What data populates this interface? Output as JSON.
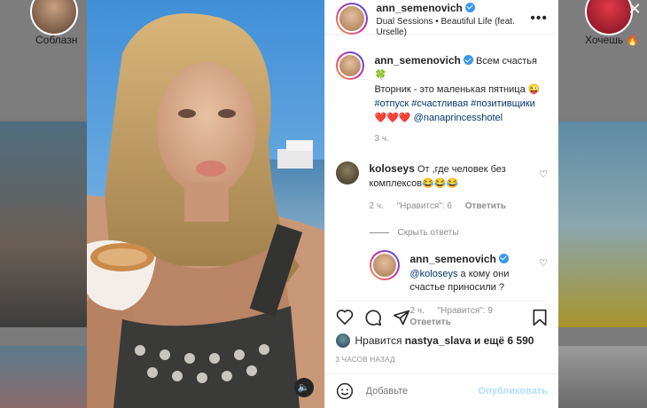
{
  "background": {
    "story_left_label": "Соблазн",
    "story_right_label": "Хочешь 🔥",
    "close_symbol": "✕"
  },
  "post": {
    "header": {
      "username": "ann_semenovich",
      "subtitle": "Dual Sessions • Beautiful Life (feat. Urselle)",
      "more_symbol": "•••"
    },
    "caption": {
      "username": "ann_semenovich",
      "line1": "Всем счастья 🍀",
      "line2": "Вторник - это маленькая пятница 😜",
      "hashtags": "#отпуск #счастливая #позитивщики",
      "hearts": "❤️❤️❤️",
      "mention": "@nanaprincesshotel",
      "time": "3 ч."
    },
    "comment1": {
      "username": "koloseys",
      "text": "От ,где человек без комплексов😂😂😂",
      "time": "2 ч.",
      "likes": "\"Нравится\": 6",
      "reply": "Ответить"
    },
    "hide_replies": "Скрыть ответы",
    "reply1": {
      "username": "ann_semenovich",
      "mention": "@koloseys",
      "text": "а кому они счастье приносили ?",
      "time": "2 ч.",
      "likes": "\"Нравится\": 9",
      "reply": "Ответить"
    },
    "likes": {
      "prefix": "Нравится",
      "user": "nastya_slava",
      "suffix": "и ещё 6 590"
    },
    "timestamp": "3 ЧАСОВ НАЗАД",
    "comment_box": {
      "placeholder": "Добавьте",
      "publish": "Опубликовать"
    }
  },
  "colors": {
    "accent": "#3897f0",
    "publish_disabled": "#b2dffc",
    "link": "#00376b"
  },
  "icons": [
    "heart-icon",
    "comment-icon",
    "share-icon",
    "bookmark-icon",
    "sound-icon",
    "verified-icon",
    "close-icon"
  ]
}
